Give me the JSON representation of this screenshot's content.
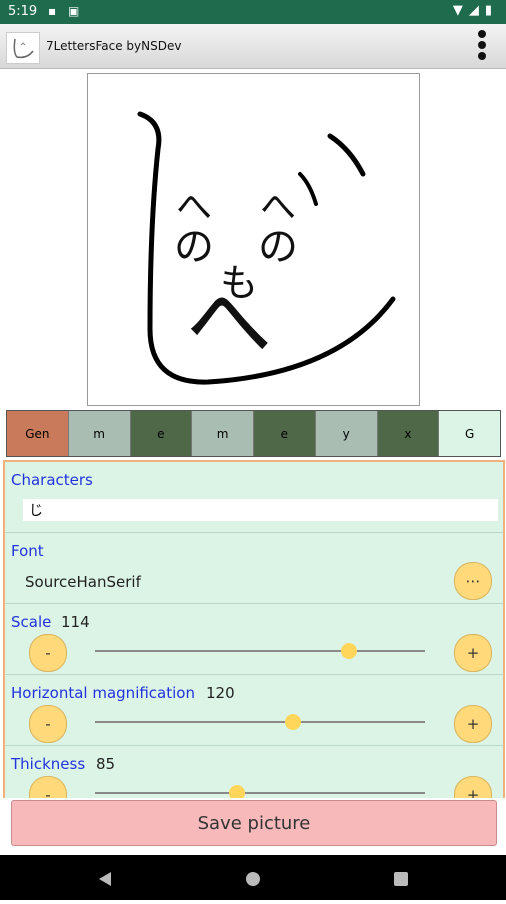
{
  "status_bar": {
    "time": "5:19"
  },
  "app_bar": {
    "title": "7LettersFace byNSDev"
  },
  "face": {
    "letters": [
      "し",
      "へ",
      "の",
      "へ",
      "の",
      "も",
      "へ"
    ]
  },
  "letter_bar": {
    "cells": [
      {
        "label": "Gen",
        "color": "#c97a5a"
      },
      {
        "label": "m",
        "color": "#a9bdb3"
      },
      {
        "label": "e",
        "color": "#4f6848"
      },
      {
        "label": "m",
        "color": "#a9bdb3"
      },
      {
        "label": "e",
        "color": "#4f6848"
      },
      {
        "label": "y",
        "color": "#a9bdb3"
      },
      {
        "label": "x",
        "color": "#4f6848"
      },
      {
        "label": "G",
        "color": "#dcf4e6"
      }
    ]
  },
  "settings": {
    "characters": {
      "label": "Characters",
      "value": "じ"
    },
    "font": {
      "label": "Font",
      "value": "SourceHanSerif",
      "button": "⋯"
    },
    "scale": {
      "label": "Scale",
      "value": "114",
      "minus": "-",
      "plus": "+",
      "level": 0.77
    },
    "horizontal": {
      "label": "Horizontal magnification",
      "value": "120",
      "minus": "-",
      "plus": "+",
      "level": 0.6
    },
    "thickness": {
      "label": "Thickness",
      "value": "85",
      "minus": "-",
      "plus": "+",
      "level": 0.43
    }
  },
  "save_button": {
    "label": "Save picture"
  },
  "icons": [
    "wifi-icon",
    "signal-icon",
    "battery-icon",
    "overflow-menu-icon",
    "nav-back-icon",
    "nav-home-icon",
    "nav-recents-icon"
  ]
}
